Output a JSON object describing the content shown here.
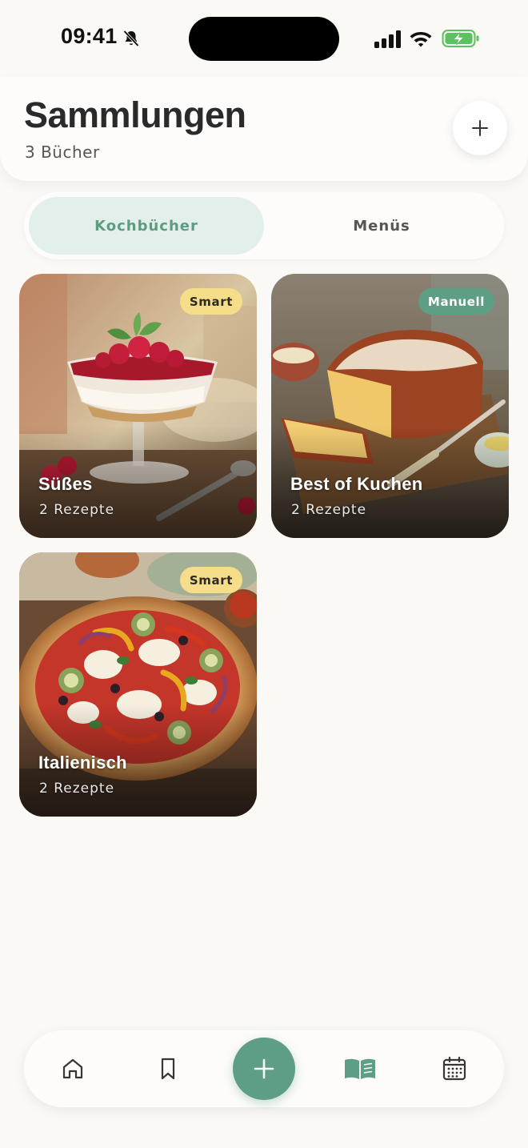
{
  "status_bar": {
    "time": "09:41"
  },
  "header": {
    "title": "Sammlungen",
    "subtitle": "3 Bücher"
  },
  "tabs": [
    {
      "label": "Kochbücher",
      "active": true
    },
    {
      "label": "Menüs",
      "active": false
    }
  ],
  "collections": [
    {
      "name": "Süßes",
      "count": "2 Rezepte",
      "badge": "Smart"
    },
    {
      "name": "Best of Kuchen",
      "count": "2 Rezepte",
      "badge": "Manuell"
    },
    {
      "name": "Italienisch",
      "count": "2 Rezepte",
      "badge": "Smart"
    }
  ],
  "nav": {
    "items": [
      "home-icon",
      "bookmark-icon",
      "plus-icon",
      "book-open-icon",
      "calendar-icon"
    ],
    "active": "book-open-icon"
  },
  "colors": {
    "accent": "#5e9e84",
    "smart_badge": "#f6dd8a",
    "tab_active_bg": "#e3efea",
    "background": "#fbf9f5"
  }
}
